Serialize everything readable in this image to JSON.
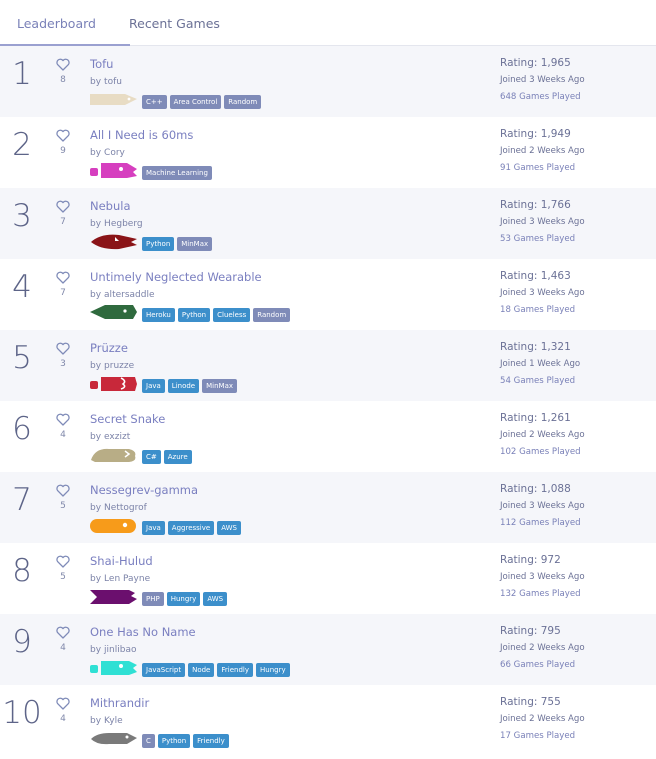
{
  "tabs": [
    {
      "label": "Leaderboard"
    },
    {
      "label": "Recent Games"
    }
  ],
  "colors": {
    "accent": "#7a7fc0",
    "tag_gray": "#7f8bb8",
    "tag_blue": "#3c8fcb"
  },
  "entries": [
    {
      "rank": "1",
      "likes": "8",
      "name": "Tofu",
      "by": "by",
      "owner": "tofu",
      "snake_color": "#e8dcc4",
      "snake_icon": "snake-head-icon",
      "tags": [
        "C++",
        "Area Control",
        "Random"
      ],
      "rating": "Rating: 1,965",
      "joined": "Joined 3 Weeks Ago",
      "games": "648 Games Played"
    },
    {
      "rank": "2",
      "likes": "9",
      "name": "All I Need is 60ms",
      "by": "by",
      "owner": "Cory",
      "snake_color": "#d63fbf",
      "snake_icon": "snake-head-icon",
      "tags": [
        "Machine Learning"
      ],
      "rating": "Rating: 1,949",
      "joined": "Joined 2 Weeks Ago",
      "games": "91 Games Played"
    },
    {
      "rank": "3",
      "likes": "7",
      "name": "Nebula",
      "by": "by",
      "owner": "Hegberg",
      "snake_color": "#8a1418",
      "snake_icon": "snake-head-icon",
      "tags": [
        "Python",
        "MinMax"
      ],
      "rating": "Rating: 1,766",
      "joined": "Joined 3 Weeks Ago",
      "games": "53 Games Played"
    },
    {
      "rank": "4",
      "likes": "7",
      "name": "Untimely Neglected Wearable",
      "by": "by",
      "owner": "altersaddle",
      "snake_color": "#2f6a3e",
      "snake_icon": "snake-head-icon",
      "tags": [
        "Heroku",
        "Python",
        "Clueless",
        "Random"
      ],
      "rating": "Rating: 1,463",
      "joined": "Joined 3 Weeks Ago",
      "games": "18 Games Played"
    },
    {
      "rank": "5",
      "likes": "3",
      "name": "Prüzze",
      "by": "by",
      "owner": "pruzze",
      "snake_color": "#c8283a",
      "snake_icon": "snake-head-icon",
      "tags": [
        "Java",
        "Linode",
        "MinMax"
      ],
      "rating": "Rating: 1,321",
      "joined": "Joined 1 Week Ago",
      "games": "54 Games Played"
    },
    {
      "rank": "6",
      "likes": "4",
      "name": "Secret Snake",
      "by": "by",
      "owner": "exzizt",
      "snake_color": "#b8ad86",
      "snake_icon": "snake-head-icon",
      "tags": [
        "C#",
        "Azure"
      ],
      "rating": "Rating: 1,261",
      "joined": "Joined 2 Weeks Ago",
      "games": "102 Games Played"
    },
    {
      "rank": "7",
      "likes": "5",
      "name": "Nessegrev-gamma",
      "by": "by",
      "owner": "Nettogrof",
      "snake_color": "#f79b1a",
      "snake_icon": "snake-head-icon",
      "tags": [
        "Java",
        "Aggressive",
        "AWS"
      ],
      "rating": "Rating: 1,088",
      "joined": "Joined 3 Weeks Ago",
      "games": "112 Games Played"
    },
    {
      "rank": "8",
      "likes": "5",
      "name": "Shai-Hulud",
      "by": "by",
      "owner": "Len Payne",
      "snake_color": "#6b0f6e",
      "snake_icon": "snake-head-icon",
      "tags": [
        "PHP",
        "Hungry",
        "AWS"
      ],
      "rating": "Rating: 972",
      "joined": "Joined 3 Weeks Ago",
      "games": "132 Games Played"
    },
    {
      "rank": "9",
      "likes": "4",
      "name": "One Has No Name",
      "by": "by",
      "owner": "jinlibao",
      "snake_color": "#2fe0d4",
      "snake_icon": "snake-head-icon",
      "tags": [
        "JavaScript",
        "Node",
        "Friendly",
        "Hungry"
      ],
      "rating": "Rating: 795",
      "joined": "Joined 2 Weeks Ago",
      "games": "66 Games Played"
    },
    {
      "rank": "10",
      "likes": "4",
      "name": "Mithrandir",
      "by": "by",
      "owner": "Kyle",
      "snake_color": "#7a7a7a",
      "snake_icon": "snake-head-icon",
      "tags": [
        "C",
        "Python",
        "Friendly"
      ],
      "rating": "Rating: 755",
      "joined": "Joined 2 Weeks Ago",
      "games": "17 Games Played"
    }
  ]
}
